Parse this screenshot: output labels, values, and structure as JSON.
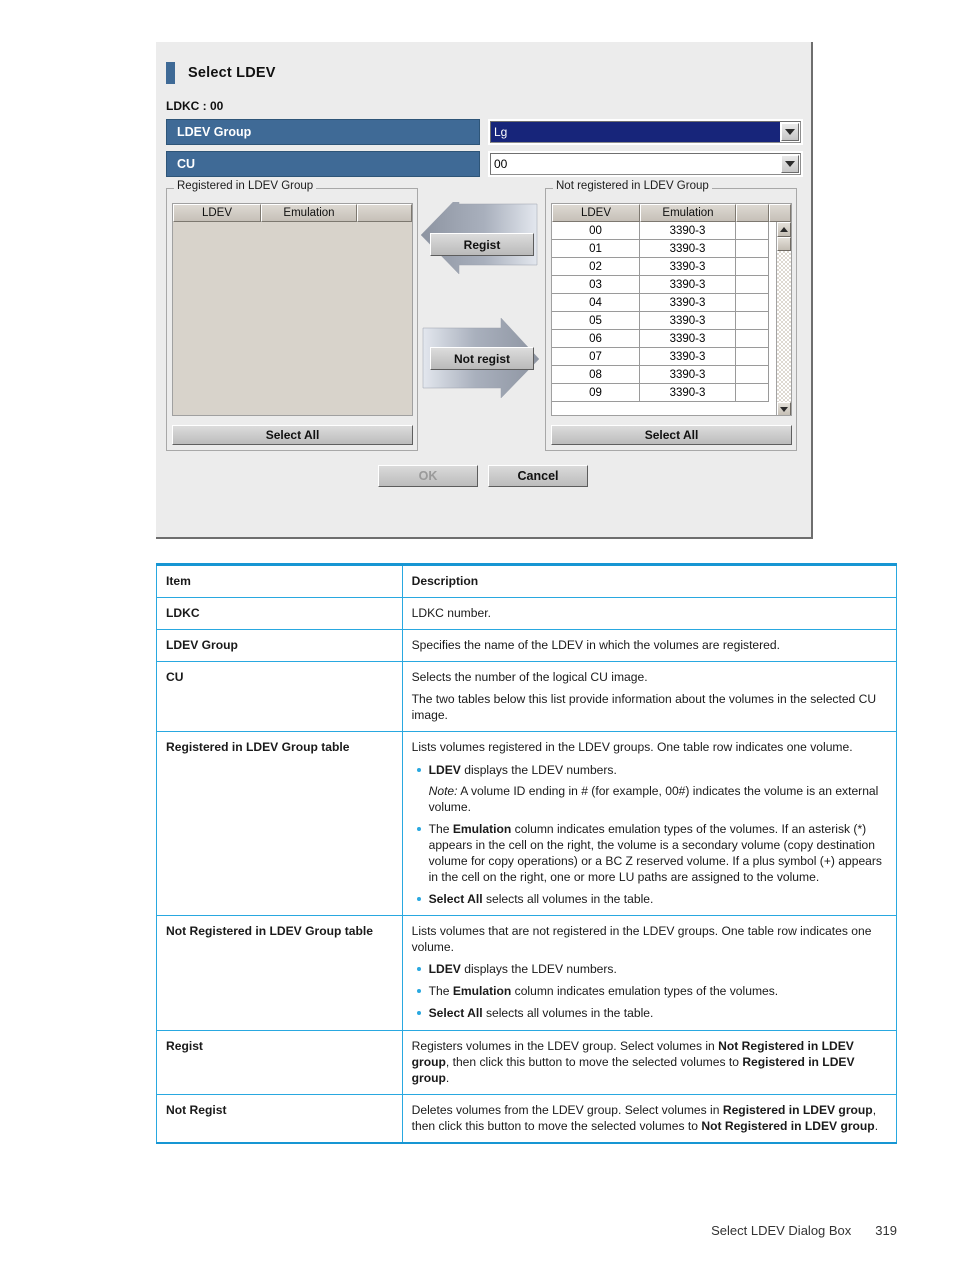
{
  "dialog": {
    "title": "Select LDEV",
    "ldkc_line": "LDKC : 00",
    "fields": [
      {
        "label": "LDEV Group",
        "value": "Lg",
        "selected": true
      },
      {
        "label": "CU",
        "value": "00",
        "selected": false
      }
    ],
    "left_panel": {
      "legend": "Registered in LDEV Group",
      "columns": [
        "LDEV",
        "Emulation",
        ""
      ],
      "rows": [],
      "select_all": "Select All"
    },
    "right_panel": {
      "legend": "Not registered in LDEV Group",
      "columns": [
        "LDEV",
        "Emulation",
        ""
      ],
      "rows": [
        {
          "ldev": "00",
          "emulation": "3390-3",
          "flag": ""
        },
        {
          "ldev": "01",
          "emulation": "3390-3",
          "flag": ""
        },
        {
          "ldev": "02",
          "emulation": "3390-3",
          "flag": ""
        },
        {
          "ldev": "03",
          "emulation": "3390-3",
          "flag": ""
        },
        {
          "ldev": "04",
          "emulation": "3390-3",
          "flag": ""
        },
        {
          "ldev": "05",
          "emulation": "3390-3",
          "flag": ""
        },
        {
          "ldev": "06",
          "emulation": "3390-3",
          "flag": ""
        },
        {
          "ldev": "07",
          "emulation": "3390-3",
          "flag": ""
        },
        {
          "ldev": "08",
          "emulation": "3390-3",
          "flag": ""
        },
        {
          "ldev": "09",
          "emulation": "3390-3",
          "flag": ""
        }
      ],
      "select_all": "Select All"
    },
    "buttons": {
      "regist": "Regist",
      "not_regist": "Not regist",
      "ok": "OK",
      "cancel": "Cancel"
    },
    "colors": {
      "field_label_bg": "#3f6a96",
      "selection_bg": "#17257a",
      "dialog_bg": "#ececec"
    }
  },
  "doc_table": {
    "headers": {
      "item": "Item",
      "description": "Description"
    },
    "rows": {
      "ldkc": {
        "item": "LDKC",
        "desc": "LDKC number."
      },
      "ldev_group": {
        "item": "LDEV Group",
        "desc": "Specifies the name of the LDEV in which the volumes are registered."
      },
      "cu": {
        "item": "CU",
        "p1": "Selects the number of the logical CU image.",
        "p2": "The two tables below this list provide information about the volumes in the selected CU image."
      },
      "registered_table": {
        "item": "Registered in LDEV Group table",
        "intro": "Lists volumes registered in the LDEV groups. One table row indicates one volume.",
        "b1_bold": "LDEV",
        "b1_rest": " displays the LDEV numbers.",
        "b1_note_label": "Note:",
        "b1_note_rest": " A volume ID ending in # (for example, 00#) indicates the volume is an external volume.",
        "b2_pre": "The ",
        "b2_bold": "Emulation",
        "b2_rest": " column indicates emulation types of the volumes. If an asterisk (*) appears in the cell on the right, the volume is a secondary volume (copy destination volume for copy operations) or a BC Z reserved volume. If a plus symbol (+) appears in the cell on the right, one or more LU paths are assigned to the volume.",
        "b3_bold": "Select All",
        "b3_rest": " selects all volumes in the table."
      },
      "not_registered_table": {
        "item": "Not Registered in LDEV Group table",
        "intro": "Lists volumes that are not registered in the LDEV groups. One table row indicates one volume.",
        "b1_bold": "LDEV",
        "b1_rest": " displays the LDEV numbers.",
        "b2_pre": "The ",
        "b2_bold": "Emulation",
        "b2_rest": " column indicates emulation types of the volumes.",
        "b3_bold": "Select All",
        "b3_rest": " selects all volumes in the table."
      },
      "regist": {
        "item": "Regist",
        "t1": "Registers volumes in the LDEV group. Select volumes in ",
        "b1": "Not Registered in LDEV group",
        "t2": ", then click this button to move the selected volumes to ",
        "b2": "Registered in LDEV group",
        "t3": "."
      },
      "not_regist": {
        "item": "Not Regist",
        "t1": "Deletes volumes from the LDEV group. Select volumes in ",
        "b1": "Registered in LDEV group",
        "t2": ", then click this button to move the selected volumes to ",
        "b2": "Not Registered in LDEV group",
        "t3": "."
      }
    }
  },
  "footer": {
    "section": "Select LDEV Dialog Box",
    "page": "319"
  }
}
